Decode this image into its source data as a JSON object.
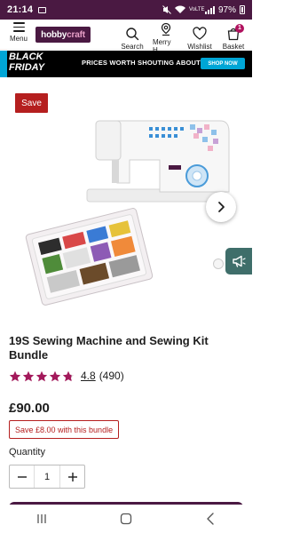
{
  "status_bar": {
    "time": "21:14",
    "network": "VoLTE",
    "battery": "97%"
  },
  "header": {
    "menu_label": "Menu",
    "logo_part1": "hobby",
    "logo_part2": "craft",
    "search_label": "Search",
    "merry_label": "Merry H...",
    "wishlist_label": "Wishlist",
    "basket_label": "Basket",
    "basket_count": "1"
  },
  "banner": {
    "line1": "BLACK",
    "line2": "FRIDAY",
    "text": "PRICES WORTH SHOUTING ABOUT",
    "button": "SHOP NOW"
  },
  "product": {
    "save_badge": "Save",
    "title": "19S Sewing Machine and Sewing Kit Bundle",
    "rating_value": "4.8",
    "rating_fraction": 0.96,
    "review_count": "(490)",
    "price": "£90.00",
    "bundle_saving": "Save £8.00 with this bundle",
    "quantity_label": "Quantity",
    "quantity_value": "1"
  },
  "colors": {
    "brand": "#4a1942",
    "sale": "#b51f1f",
    "star": "#a3195b",
    "accent": "#00a6d6",
    "feedback": "#3f6e6a"
  }
}
